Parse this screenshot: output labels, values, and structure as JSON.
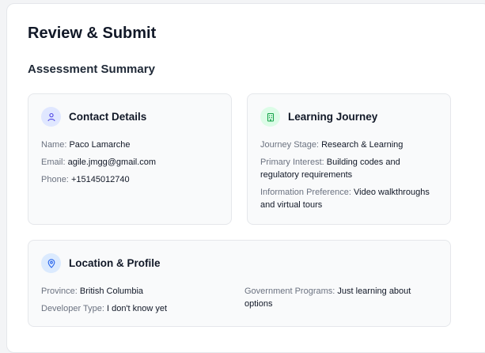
{
  "page": {
    "title": "Review & Submit",
    "section_title": "Assessment Summary"
  },
  "cards": {
    "contact": {
      "title": "Contact Details",
      "icon": "user-icon",
      "fields": [
        {
          "label": "Name:",
          "value": "Paco Lamarche"
        },
        {
          "label": "Email:",
          "value": "agile.jmgg@gmail.com"
        },
        {
          "label": "Phone:",
          "value": "+15145012740"
        }
      ]
    },
    "journey": {
      "title": "Learning Journey",
      "icon": "building-icon",
      "fields": [
        {
          "label": "Journey Stage:",
          "value": "Research & Learning"
        },
        {
          "label": "Primary Interest:",
          "value": "Building codes and regulatory requirements"
        },
        {
          "label": "Information Preference:",
          "value": "Video walkthroughs and virtual tours"
        }
      ]
    },
    "location": {
      "title": "Location & Profile",
      "icon": "location-pin-icon",
      "fields": [
        {
          "label": "Province:",
          "value": "British Columbia"
        },
        {
          "label": "Developer Type:",
          "value": "I don't know yet"
        },
        {
          "label": "Government Programs:",
          "value": "Just learning about options"
        }
      ]
    }
  },
  "colors": {
    "contact_icon": "#4f46e5",
    "journey_icon": "#16a34a",
    "location_icon": "#2563eb"
  }
}
